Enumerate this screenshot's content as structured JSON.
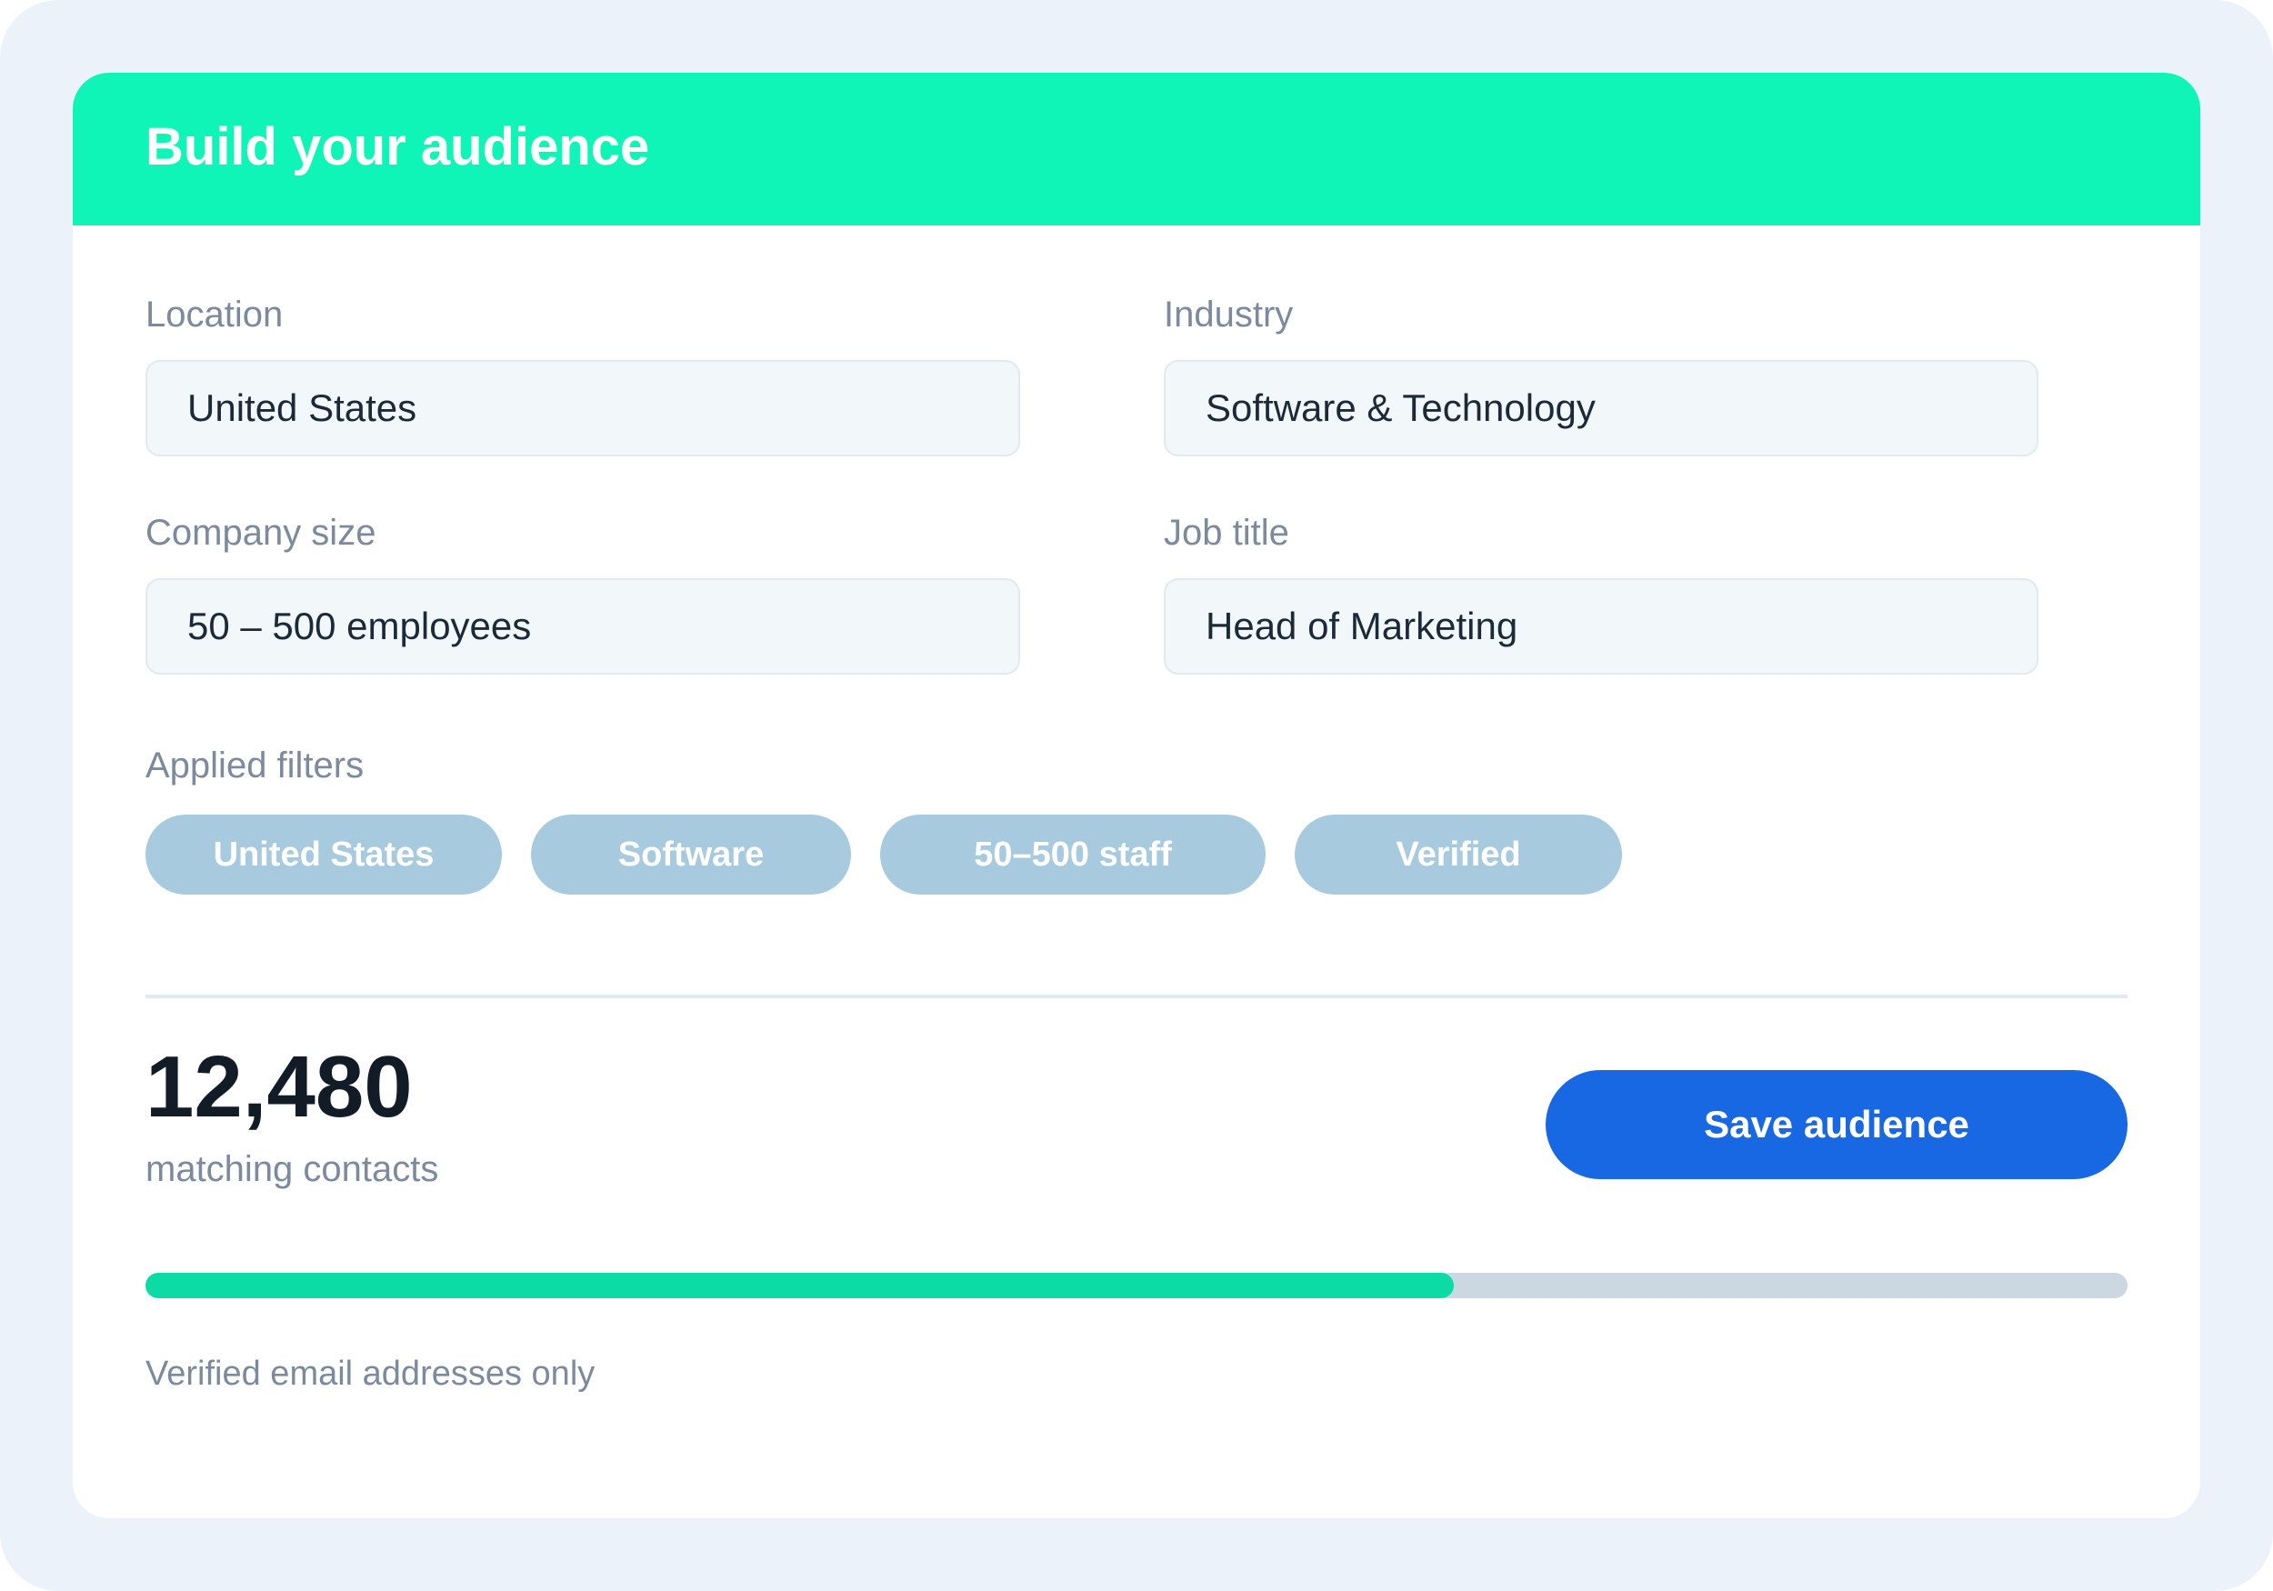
{
  "card": {
    "title": "Build your audience"
  },
  "fields": {
    "location": {
      "label": "Location",
      "value": "United States"
    },
    "industry": {
      "label": "Industry",
      "value": "Software & Technology"
    },
    "company_size": {
      "label": "Company size",
      "value": "50 – 500 employees"
    },
    "job_title": {
      "label": "Job title",
      "value": "Head of Marketing"
    }
  },
  "filters": {
    "label": "Applied filters",
    "chips": [
      "United States",
      "Software",
      "50–500 staff",
      "Verified"
    ]
  },
  "summary": {
    "count": "12,480",
    "caption": "matching contacts",
    "save_label": "Save audience",
    "progress_fraction": 0.66,
    "note": "Verified email addresses only"
  },
  "colors": {
    "header": "#0ef5b7",
    "accent_button": "#1868e3",
    "progress_fill": "#0ddba5",
    "chip": "#a8cadf"
  }
}
